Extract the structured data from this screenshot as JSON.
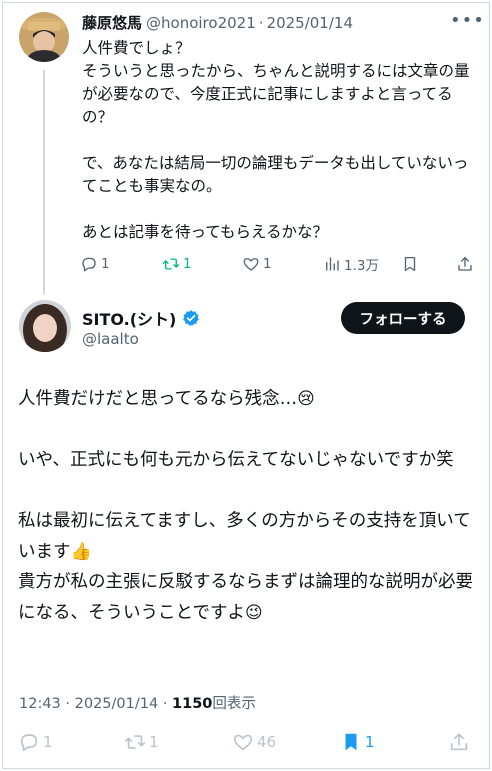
{
  "reply": {
    "author_name": "藤原悠馬",
    "handle": "@honoiro2021",
    "separator": "·",
    "date": "2025/01/14",
    "more": "•••",
    "text": "人件費でしょ？\nそういうと思ったから、ちゃんと説明するには文章の量が必要なので、今度正式に記事にしますよと言ってるの？\n\nで、あなたは結局一切の論理もデータも出していないってことも事実なの。\n\nあとは記事を待ってもらえるかな？",
    "actions": {
      "replies": "1",
      "retweets": "1",
      "likes": "1",
      "views": "1.3万"
    }
  },
  "main": {
    "author_name": "SITO.(シト)",
    "handle": "@laalto",
    "follow_label": "フォローする",
    "paragraphs": [
      {
        "text": "人件費だけだと思ってるなら残念…",
        "emoji": "😢"
      },
      {
        "text": "",
        "emoji": ""
      },
      {
        "text": "いや、正式にも何も元から伝えてないじゃないですか笑",
        "emoji": ""
      },
      {
        "text": "",
        "emoji": ""
      },
      {
        "text": "私は最初に伝えてますし、多くの方からその支持を頂いています",
        "emoji": "👍"
      },
      {
        "text": "貴方が私の主張に反駁するならまずは論理的な説明が必要になる、そういうことですよ",
        "emoji": "😉"
      }
    ],
    "meta": {
      "time": "12:43",
      "separator": "·",
      "date": "2025/01/14",
      "views_count": "1150",
      "views_label": "回表示"
    },
    "actions": {
      "replies": "1",
      "retweets": "1",
      "likes": "46",
      "bookmarks": "1"
    }
  },
  "colors": {
    "text": "#0f1419",
    "secondary": "#536471",
    "retweet_green": "#00ba7c",
    "bookmark_blue": "#1d9bf0",
    "verified_blue": "#1d9bf0",
    "follow_button_bg": "#0f1419"
  }
}
